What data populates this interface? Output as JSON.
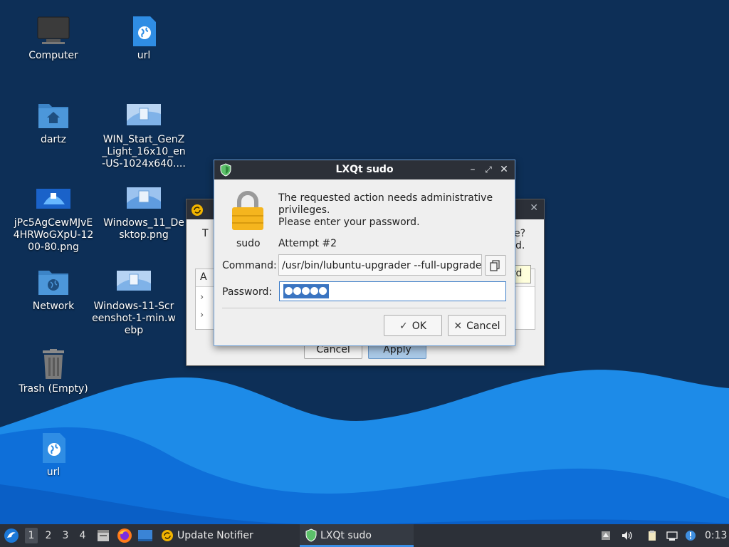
{
  "desktop": {
    "icons": [
      {
        "label": "Computer"
      },
      {
        "label": "url"
      },
      {
        "label": "dartz"
      },
      {
        "label": "WIN_Start_GenZ_Light_16x10_en-US-1024x640...."
      },
      {
        "label": "jPc5AgCewMJvE4HRWoGXpU-1200-80.png"
      },
      {
        "label": "Windows_11_Desktop.png"
      },
      {
        "label": "Network"
      },
      {
        "label": "Windows-11-Screenshot-1-min.webp"
      },
      {
        "label": "Trash (Empty)"
      },
      {
        "label": "url"
      }
    ]
  },
  "background_dialog": {
    "frag_left": "T",
    "frag_right_1": "e?",
    "frag_right_2": "d.",
    "tree_header_frag": "A",
    "cancel_label": "Cancel",
    "apply_label": "Apply",
    "tooltip_frag": "rd"
  },
  "sudo_dialog": {
    "title": "LXQt sudo",
    "message_line1": "The requested action needs administrative",
    "message_line2": "privileges.",
    "message_line3": "Please enter your password.",
    "user": "sudo",
    "attempt": "Attempt #2",
    "command_label": "Command:",
    "command_value": "/usr/bin/lubuntu-upgrader --full-upgrade",
    "password_label": "Password:",
    "password_length": 5,
    "ok_label": "OK",
    "cancel_label": "Cancel"
  },
  "taskbar": {
    "workspaces": [
      "1",
      "2",
      "3",
      "4"
    ],
    "active_workspace": "1",
    "tasks": [
      {
        "label": "Update Notifier"
      },
      {
        "label": "LXQt sudo",
        "active": true
      }
    ],
    "clock": "0:13"
  },
  "colors": {
    "desktop_bg": "#0d2f57",
    "titlebar": "#2c3038",
    "accent": "#3a74c1",
    "wave_light": "#3aa3ef",
    "wave_dark": "#0d6ad8"
  }
}
